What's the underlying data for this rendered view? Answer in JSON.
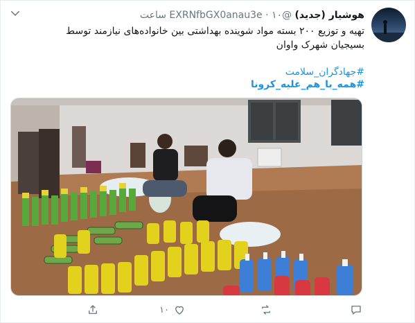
{
  "header": {
    "display_name": "هوشیار (جدید)",
    "handle": "@EXRNfbGX0anau3e",
    "separator": "·",
    "time": "۱۰ ساعت"
  },
  "tweet": {
    "text": "تهیه و توزیع ۲۰۰ بسته مواد شوینده بهداشتی بین خانواده‌های نیازمند توسط بسیجیان شهرک واوان",
    "hashtags": [
      "#جهادگران_سلامت",
      "#همه_با_هم_علیه_کرونا"
    ]
  },
  "actions": {
    "reply_count": "",
    "retweet_count": "",
    "like_count": "۱۰"
  },
  "colors": {
    "link": "#1b95e0",
    "secondary_text": "#657786",
    "primary_text": "#14171a"
  }
}
